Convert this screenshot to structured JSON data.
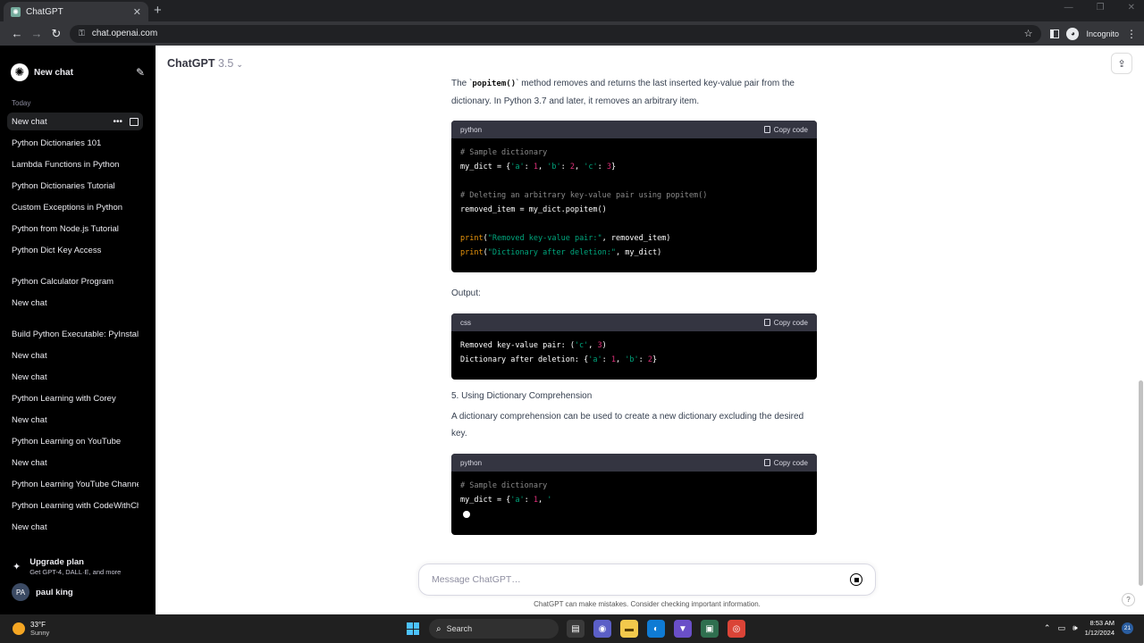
{
  "browser": {
    "tab_title": "ChatGPT",
    "url": "chat.openai.com",
    "incognito_label": "Incognito"
  },
  "sidebar": {
    "new_chat_label": "New chat",
    "section_today": "Today",
    "items": [
      "New chat",
      "Python Dictionaries 101",
      "Lambda Functions in Python",
      "Python Dictionaries Tutorial",
      "Custom Exceptions in Python",
      "Python from Node.js Tutorial",
      "Python Dict Key Access",
      "Python Calculator Program",
      "New chat",
      "Build Python Executable: PyInstaller",
      "New chat",
      "New chat",
      "Python Learning with Corey",
      "New chat",
      "Python Learning on YouTube",
      "New chat",
      "Python Learning YouTube Channel",
      "Python Learning with CodeWithChris",
      "New chat"
    ],
    "upgrade_title": "Upgrade plan",
    "upgrade_sub": "Get GPT-4, DALL·E, and more",
    "user_initials": "PA",
    "user_name": "paul king"
  },
  "header": {
    "model_name": "ChatGPT",
    "model_version": "3.5"
  },
  "message": {
    "para1_pre": "The `",
    "para1_code": "popitem()",
    "para1_post": "` method removes and returns the last inserted key-value pair from the dictionary. In Python 3.7 and later, it removes an arbitrary item.",
    "copy_label": "Copy code",
    "code1_lang": "python",
    "output_label": "Output:",
    "code2_lang": "css",
    "heading5": "5. Using Dictionary Comprehension",
    "para2": "A dictionary comprehension can be used to create a new dictionary excluding the desired key.",
    "code3_lang": "python"
  },
  "composer": {
    "placeholder": "Message ChatGPT…",
    "disclaimer": "ChatGPT can make mistakes. Consider checking important information."
  },
  "taskbar": {
    "temperature": "33°F",
    "condition": "Sunny",
    "search_label": "Search",
    "time": "8:53 AM",
    "date": "1/12/2024",
    "notifications": "21"
  },
  "colors": {
    "sidebar_bg": "#000000",
    "code_header": "#343541",
    "string": "#00a67d",
    "number": "#df3079",
    "keyword": "#e9950c"
  }
}
